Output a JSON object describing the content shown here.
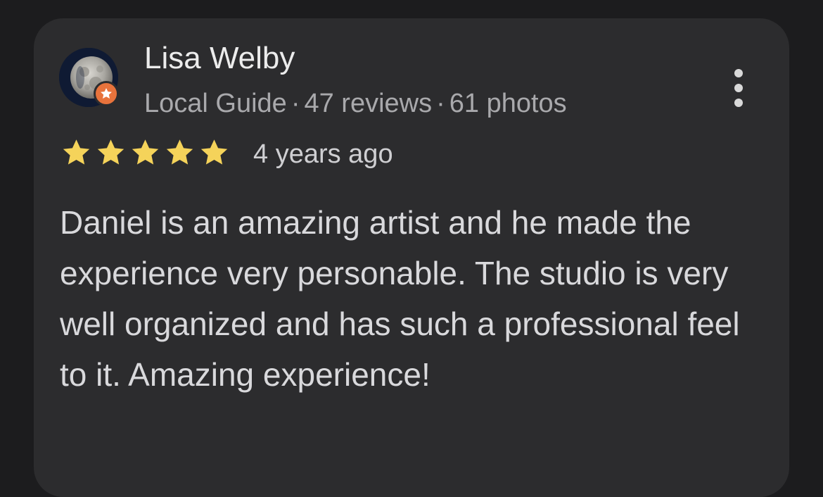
{
  "review": {
    "author": {
      "name": "Lisa Welby",
      "avatar_icon": "moon-avatar",
      "badge_icon": "local-guide-star-icon",
      "badge_color": "#e8733c",
      "role": "Local Guide",
      "separator": "·",
      "reviews": "47 reviews",
      "photos": "61 photos"
    },
    "menu_icon": "more-vert-icon",
    "rating": {
      "value": 5,
      "max": 5,
      "star_color": "#f5d35a"
    },
    "time": "4 years ago",
    "text": "Daniel is an amazing artist and he made the experience very personable. The studio is very well organized and has such a professional feel to it. Amazing experience!"
  },
  "theme": {
    "background": "#1c1c1e",
    "card": "#2c2c2e",
    "primary_text": "#ececec",
    "secondary_text": "#a9a9ac"
  }
}
